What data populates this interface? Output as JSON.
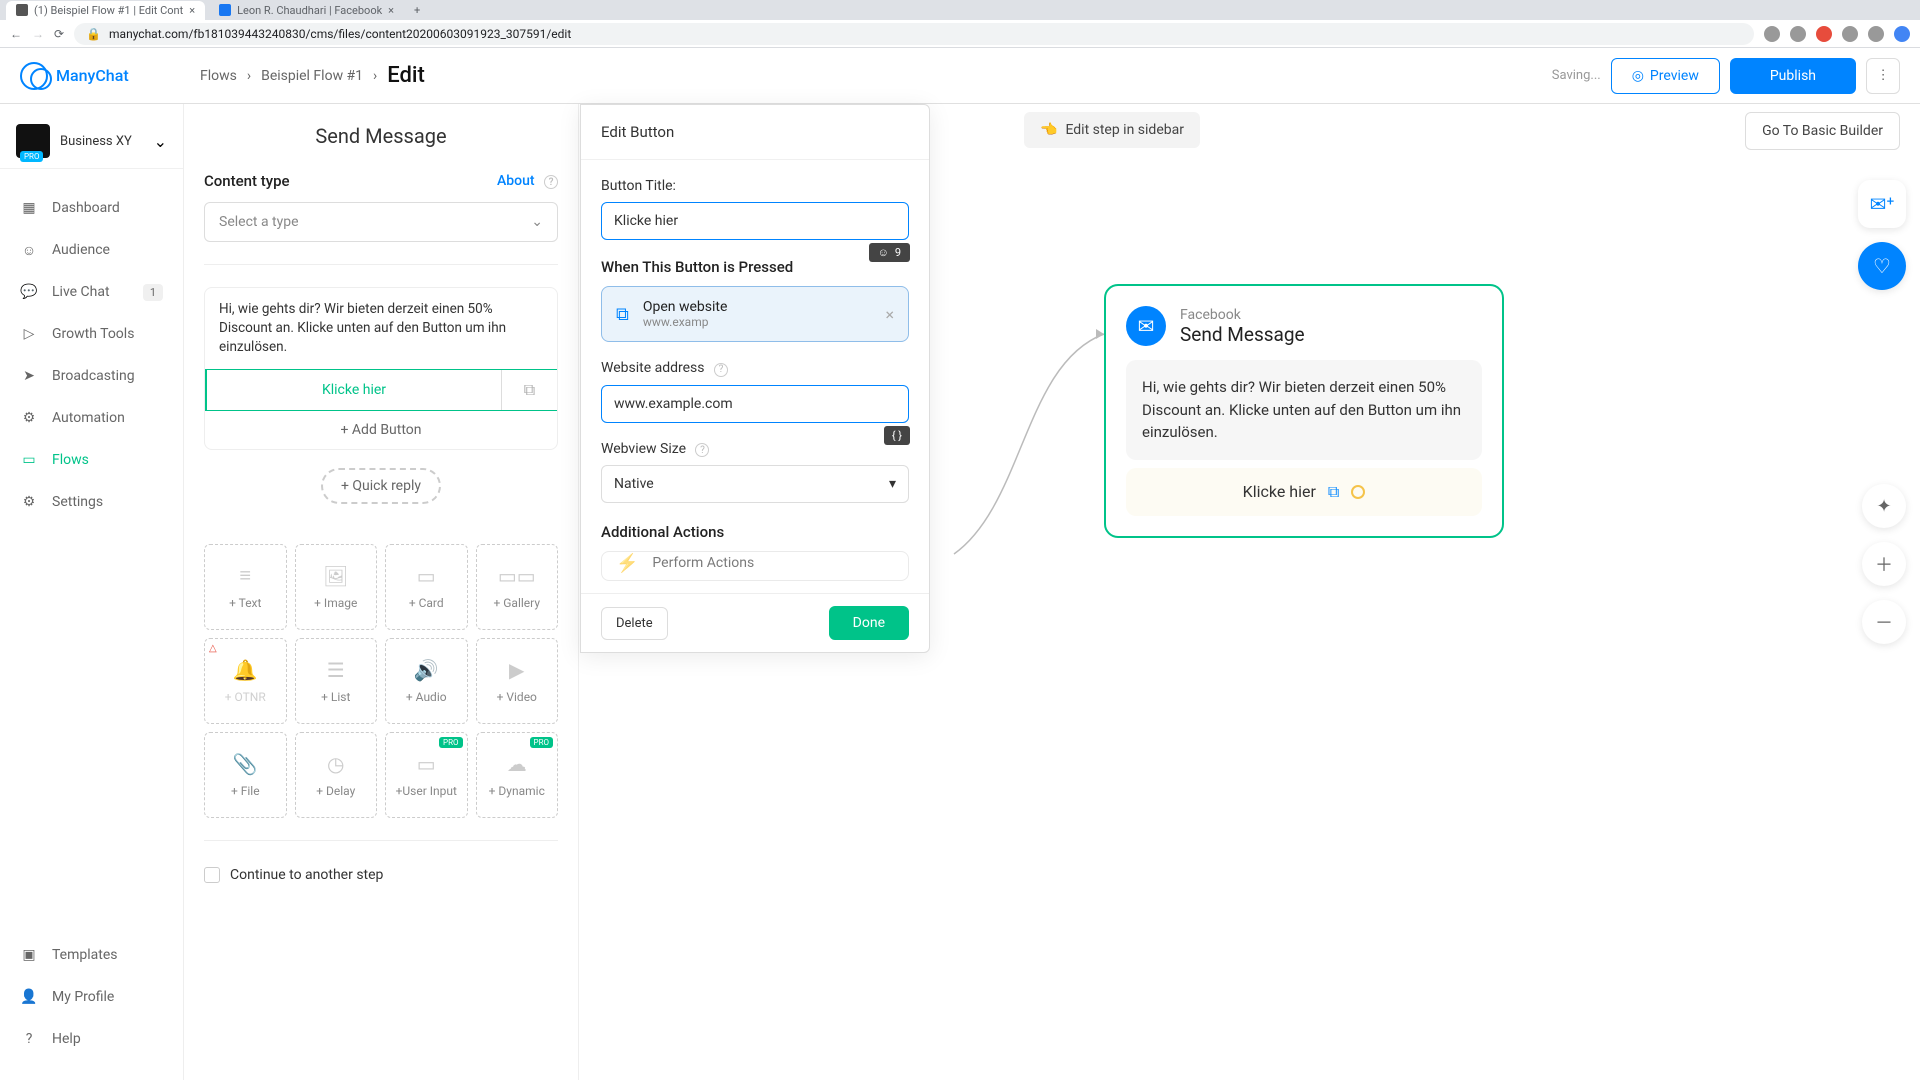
{
  "browser": {
    "tabs": [
      {
        "title": "(1) Beispiel Flow #1 | Edit Cont"
      },
      {
        "title": "Leon R. Chaudhari | Facebook"
      }
    ],
    "url": "manychat.com/fb181039443240830/cms/files/content20200603091923_307591/edit"
  },
  "brand": "ManyChat",
  "workspace": {
    "name": "Business XY"
  },
  "sidebar": {
    "items": [
      {
        "label": "Dashboard"
      },
      {
        "label": "Audience"
      },
      {
        "label": "Live Chat",
        "badge": "1"
      },
      {
        "label": "Growth Tools"
      },
      {
        "label": "Broadcasting"
      },
      {
        "label": "Automation"
      },
      {
        "label": "Flows"
      },
      {
        "label": "Settings"
      }
    ],
    "bottom": [
      {
        "label": "Templates"
      },
      {
        "label": "My Profile"
      },
      {
        "label": "Help"
      }
    ]
  },
  "breadcrumbs": {
    "a": "Flows",
    "b": "Beispiel Flow #1",
    "c": "Edit"
  },
  "header": {
    "saving": "Saving...",
    "preview": "Preview",
    "publish": "Publish"
  },
  "editor": {
    "title": "Send Message",
    "contentType": "Content type",
    "about": "About",
    "selectType": "Select a type",
    "messageText": "Hi, wie gehts dir? Wir bieten derzeit einen 50% Discount an. Klicke unten auf den Button um ihn einzulösen.",
    "buttonLabel": "Klicke hier",
    "addButton": "+ Add Button",
    "quickReply": "+ Quick reply",
    "tiles": [
      "+ Text",
      "+ Image",
      "+ Card",
      "+ Gallery",
      "+ OTNR",
      "+ List",
      "+ Audio",
      "+ Video",
      "+ File",
      "+ Delay",
      "+User Input",
      "+ Dynamic"
    ],
    "continue": "Continue to another step"
  },
  "popover": {
    "title": "Edit Button",
    "buttonTitleLab": "Button Title:",
    "buttonTitleVal": "Klicke hier",
    "charCount": "9",
    "whenPressed": "When This Button is Pressed",
    "action": {
      "title": "Open website",
      "sub": "www.examp"
    },
    "websiteAddrLab": "Website address",
    "websiteAddrVal": "www.example.com",
    "varBadge": "{ }",
    "webviewLab": "Webview Size",
    "webviewVal": "Native",
    "additional": "Additional Actions",
    "performActions": "Perform Actions",
    "delete": "Delete",
    "done": "Done"
  },
  "canvas": {
    "editChip": "Edit step in sidebar",
    "goBasic": "Go To Basic Builder",
    "node": {
      "sub": "Facebook",
      "title": "Send Message",
      "msg": "Hi, wie gehts dir? Wir bieten derzeit einen 50% Discount an. Klicke unten auf den Button um ihn einzulösen.",
      "btn": "Klicke hier"
    }
  }
}
